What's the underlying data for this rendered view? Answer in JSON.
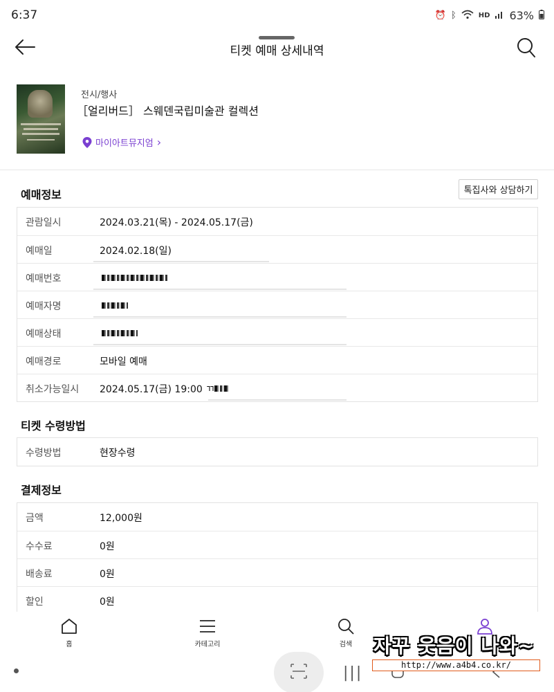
{
  "status_bar": {
    "time": "6:37",
    "battery": "63%",
    "network": "HD"
  },
  "header": {
    "title": "티켓 예매 상세내역"
  },
  "event": {
    "category": "전시/행사",
    "name": "［얼리버드］ 스웨덴국립미술관 컬렉션",
    "venue": "마이아트뮤지엄",
    "venue_arrow": "›"
  },
  "reservation": {
    "title": "예매정보",
    "consult_button": "톡집사와 상담하기",
    "rows": [
      {
        "label": "관람일시",
        "value": "2024.03.21(목) - 2024.05.17(금)"
      },
      {
        "label": "예매일",
        "value": "2024.02.18(일)"
      },
      {
        "label": "예매번호",
        "value": ""
      },
      {
        "label": "예매자명",
        "value": ""
      },
      {
        "label": "예매상태",
        "value": ""
      },
      {
        "label": "예매경로",
        "value": "모바일 예매"
      },
      {
        "label": "취소가능일시",
        "value": "2024.05.17(금) 19:00 ㄲ"
      }
    ]
  },
  "receipt": {
    "title": "티켓 수령방법",
    "rows": [
      {
        "label": "수령방법",
        "value": "현장수령"
      }
    ]
  },
  "payment": {
    "title": "결제정보",
    "rows": [
      {
        "label": "금액",
        "value": "12,000원"
      },
      {
        "label": "수수료",
        "value": "0원"
      },
      {
        "label": "배송료",
        "value": "0원"
      },
      {
        "label": "할인",
        "value": "0원"
      }
    ]
  },
  "bottom_nav": {
    "items": [
      {
        "label": "홈",
        "icon": "home-icon"
      },
      {
        "label": "카테고리",
        "icon": "menu-icon"
      },
      {
        "label": "검색",
        "icon": "search-icon"
      },
      {
        "label": "",
        "icon": "user-icon"
      }
    ]
  },
  "watermark": {
    "title": "자꾸 웃음이 나와~",
    "url": "http://www.a4b4.co.kr/"
  },
  "colors": {
    "accent": "#7a3fd1",
    "border": "#e2e2e2"
  }
}
